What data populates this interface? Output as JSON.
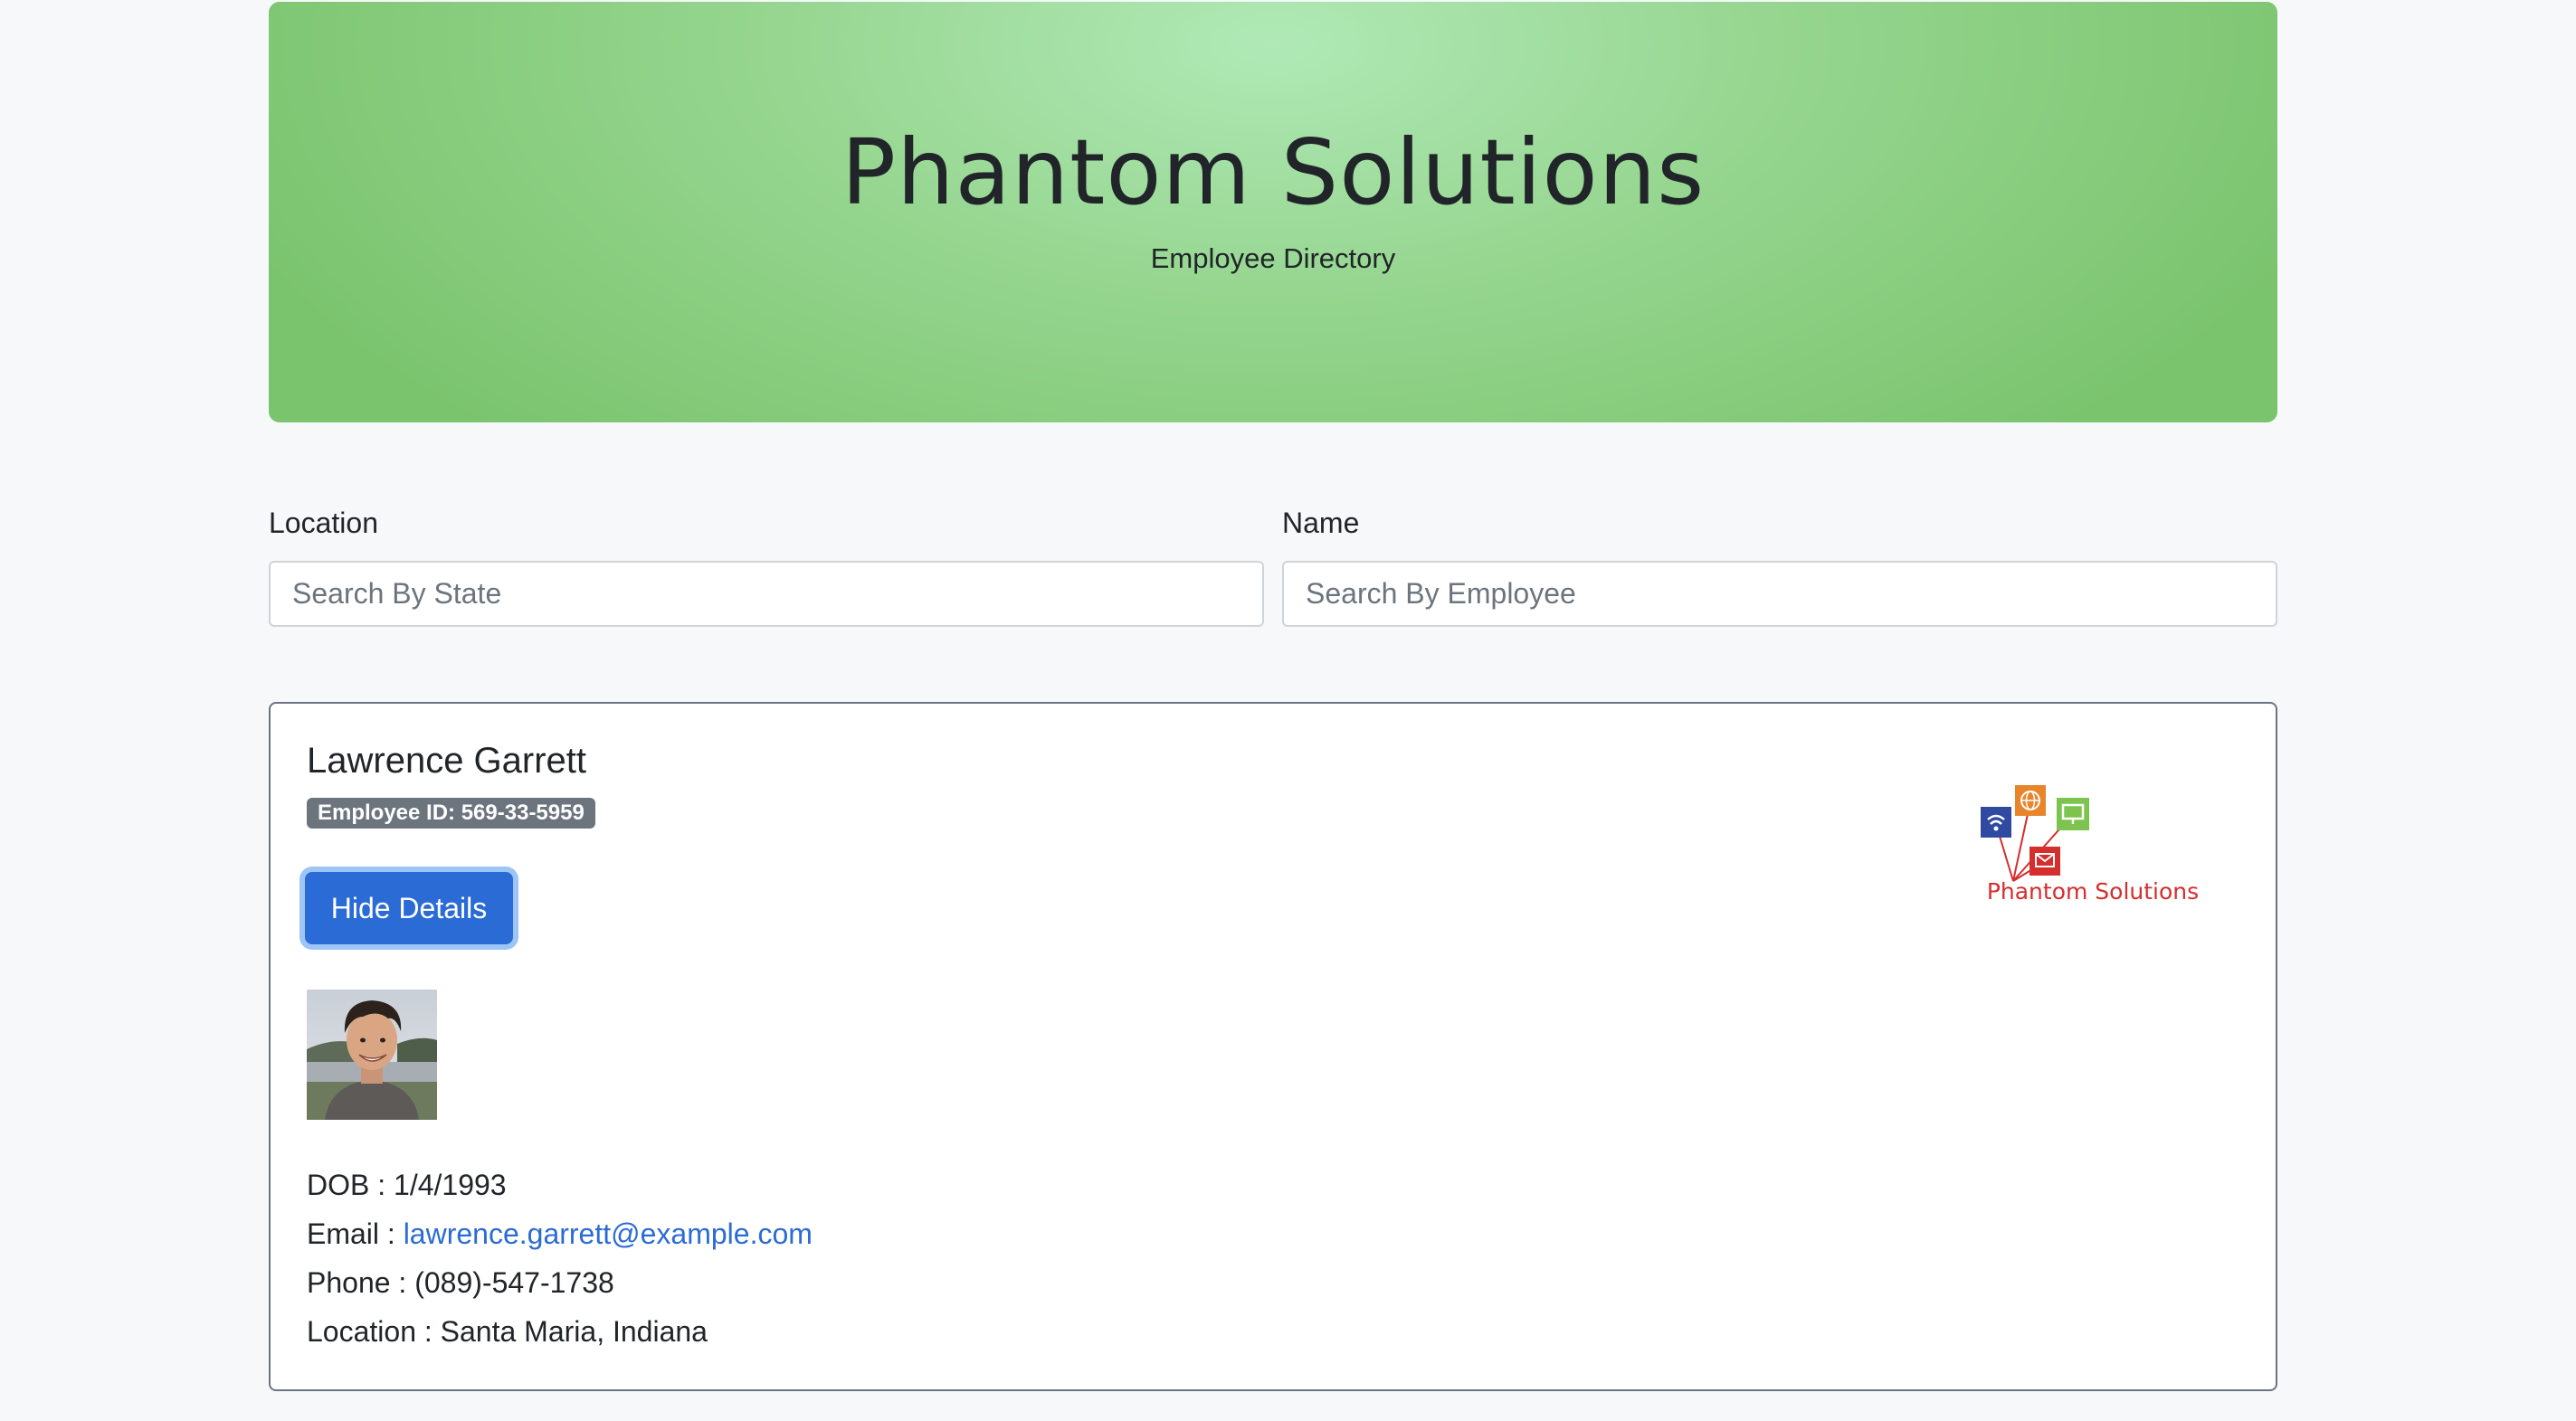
{
  "header": {
    "title": "Phantom Solutions",
    "subtitle": "Employee Directory"
  },
  "filters": {
    "location_label": "Location",
    "location_placeholder": "Search By State",
    "name_label": "Name",
    "name_placeholder": "Search By Employee"
  },
  "employee": {
    "name": "Lawrence Garrett",
    "badge": "Employee ID: 569-33-5959",
    "toggle_label": "Hide Details",
    "dob_label": "DOB :",
    "dob": "1/4/1993",
    "email_label": "Email :",
    "email": "lawrence.garrett@example.com",
    "phone_label": "Phone :",
    "phone": "(089)-547-1738",
    "location_label": "Location :",
    "location": "Santa Maria, Indiana"
  },
  "logo": {
    "text": "Phantom Solutions",
    "colors": [
      "#2f4aa0",
      "#e8852b",
      "#7cc44e",
      "#d62d2d"
    ]
  },
  "colors": {
    "primary_button": "#2b6bd6",
    "link": "#2b6bd6",
    "badge": "#6c757d",
    "hero_light": "#b0e9b6",
    "hero_dark": "#7bc46e"
  }
}
